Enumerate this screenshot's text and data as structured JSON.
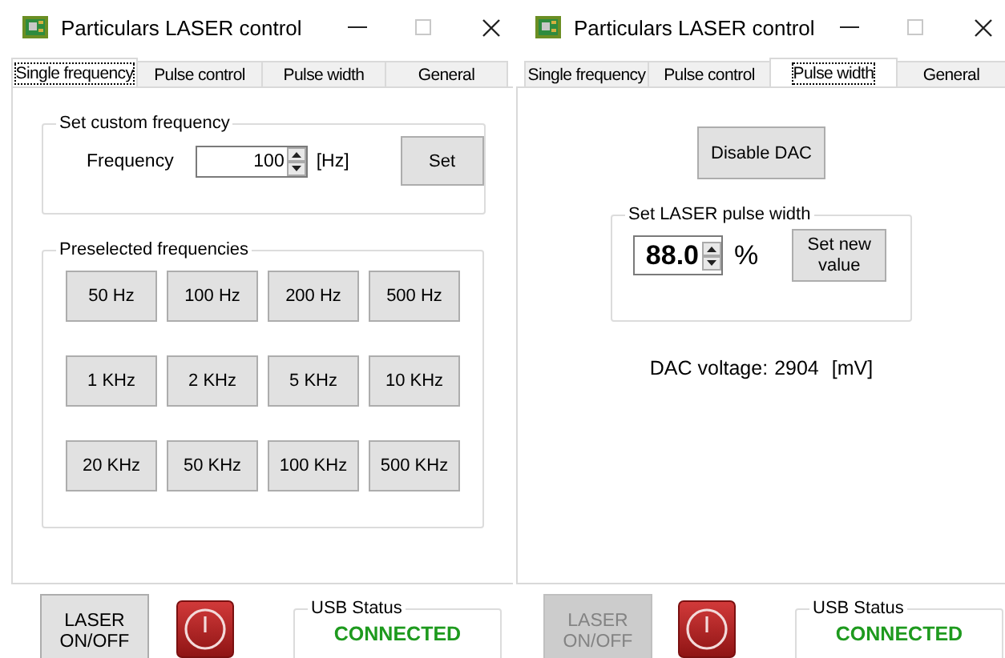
{
  "windows": [
    {
      "title": "Particulars LASER control",
      "tabs": [
        {
          "label": "Single frequency",
          "selected": true
        },
        {
          "label": "Pulse control",
          "selected": false
        },
        {
          "label": "Pulse width",
          "selected": false
        },
        {
          "label": "General",
          "selected": false
        }
      ],
      "panel": {
        "kind": "single_frequency",
        "custom_group": {
          "title": "Set custom frequency",
          "label": "Frequency",
          "value": "100",
          "unit": "[Hz]",
          "button": "Set"
        },
        "preset_group": {
          "title": "Preselected frequencies",
          "buttons": [
            "50 Hz",
            "100 Hz",
            "200 Hz",
            "500 Hz",
            "1 KHz",
            "2 KHz",
            "5 KHz",
            "10 KHz",
            "20 KHz",
            "50 KHz",
            "100 KHz",
            "500 KHz"
          ]
        }
      },
      "footer": {
        "laser_button": {
          "label": "LASER ON/OFF",
          "disabled": false
        },
        "usb": {
          "title": "USB Status",
          "status": "CONNECTED"
        }
      }
    },
    {
      "title": "Particulars LASER control",
      "tabs": [
        {
          "label": "Single frequency",
          "selected": false
        },
        {
          "label": "Pulse control",
          "selected": false
        },
        {
          "label": "Pulse width",
          "selected": true
        },
        {
          "label": "General",
          "selected": false
        }
      ],
      "panel": {
        "kind": "pulse_width",
        "dac_button": "Disable DAC",
        "width_group": {
          "title": "Set LASER pulse width",
          "value": "88.0",
          "unit": "%",
          "button": "Set new value"
        },
        "dac_label": "DAC voltage:",
        "dac_value": "2904",
        "dac_unit": "[mV]"
      },
      "footer": {
        "laser_button": {
          "label": "LASER ON/OFF",
          "disabled": true
        },
        "usb": {
          "title": "USB Status",
          "status": "CONNECTED"
        }
      }
    }
  ]
}
